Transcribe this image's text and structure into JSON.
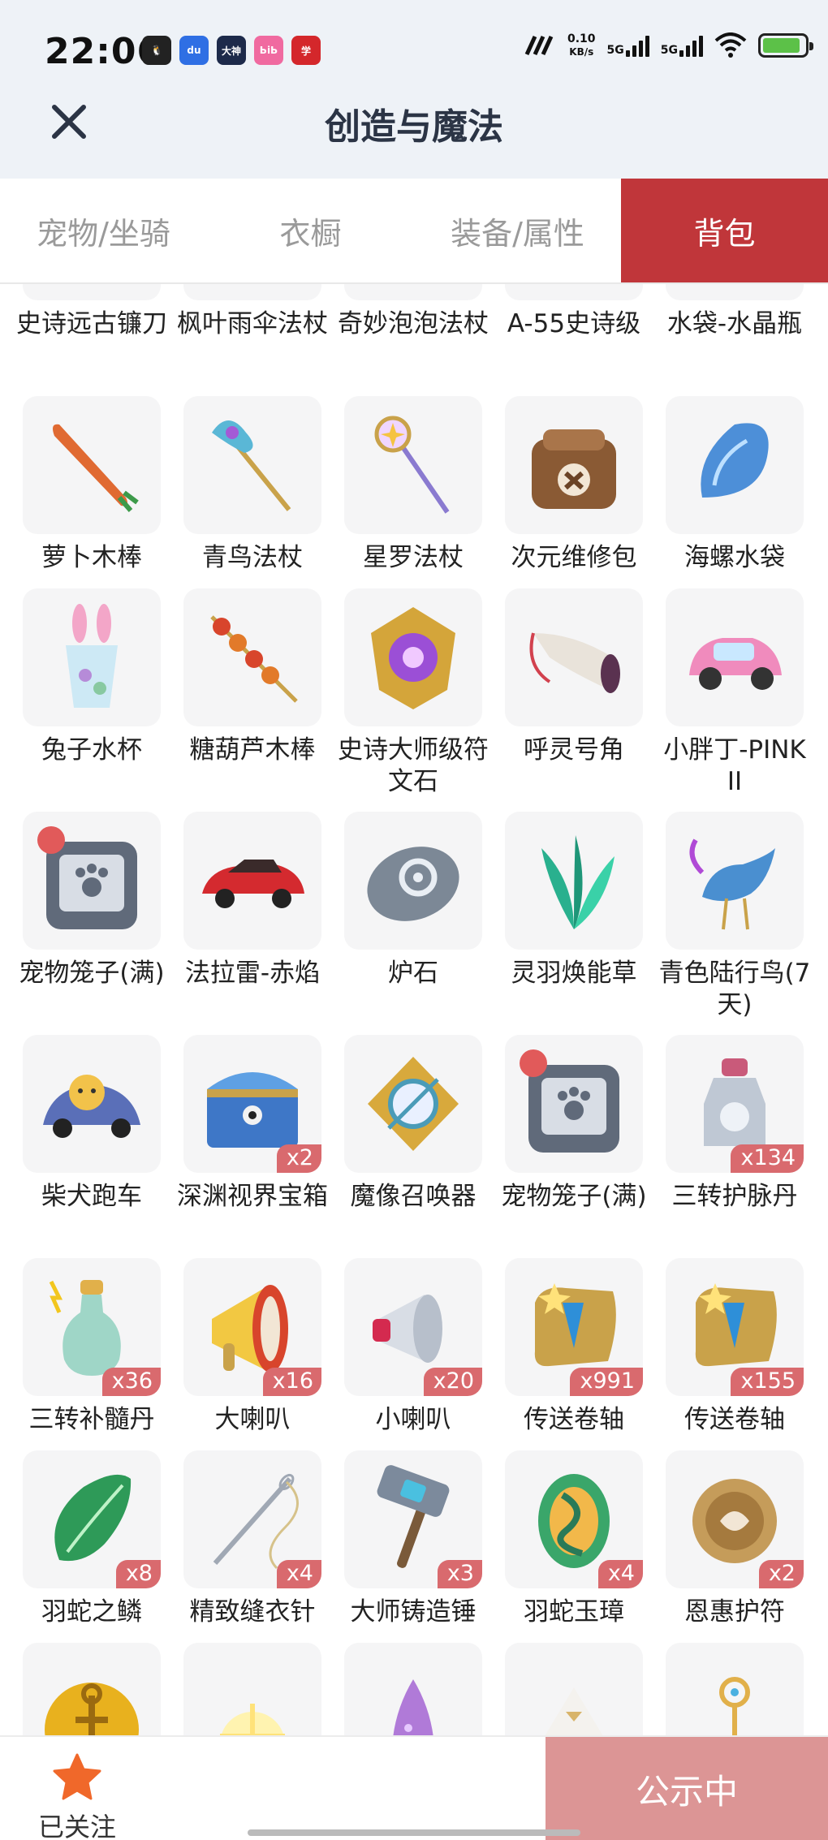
{
  "status_bar": {
    "time": "22:06",
    "network_speed_value": "0.10",
    "network_speed_unit": "KB/s",
    "signal1": "5G",
    "signal2": "5G",
    "apps": [
      {
        "name": "qq-icon",
        "color": "#222222",
        "text": "🐧"
      },
      {
        "name": "baidu-icon",
        "color": "#2f6fe4",
        "text": "du"
      },
      {
        "name": "dashen-icon",
        "color": "#1d2a4a",
        "text": "大神"
      },
      {
        "name": "bilibili-icon",
        "color": "#f06aa0",
        "text": "ЬiЬ"
      },
      {
        "name": "xuexi-icon",
        "color": "#d4272b",
        "text": "学"
      }
    ]
  },
  "header": {
    "title": "创造与魔法"
  },
  "tabs": [
    {
      "label": "宠物/坐骑",
      "active": false
    },
    {
      "label": "衣橱",
      "active": false
    },
    {
      "label": "装备/属性",
      "active": false
    },
    {
      "label": "背包",
      "active": true
    }
  ],
  "partial_row": [
    {
      "label": "史诗远古镰刀",
      "icon": "scythe"
    },
    {
      "label": "枫叶雨伞法杖",
      "icon": "umbrella-staff"
    },
    {
      "label": "奇妙泡泡法杖",
      "icon": "bubble-staff"
    },
    {
      "label": "A-55史诗级",
      "icon": "a55"
    },
    {
      "label": "水袋-水晶瓶",
      "icon": "crystal-bottle"
    }
  ],
  "items": [
    {
      "label": "萝卜木棒",
      "icon": "carrot",
      "qty": ""
    },
    {
      "label": "青鸟法杖",
      "icon": "bluebird-staff",
      "qty": ""
    },
    {
      "label": "星罗法杖",
      "icon": "star-staff",
      "qty": ""
    },
    {
      "label": "次元维修包",
      "icon": "repair-bag",
      "qty": ""
    },
    {
      "label": "海螺水袋",
      "icon": "conch",
      "qty": ""
    },
    {
      "label": "兔子水杯",
      "icon": "rabbit-cup",
      "qty": ""
    },
    {
      "label": "糖葫芦木棒",
      "icon": "candied-haws",
      "qty": ""
    },
    {
      "label": "史诗大师级符文石",
      "icon": "rune-stone",
      "qty": ""
    },
    {
      "label": "呼灵号角",
      "icon": "horn",
      "qty": ""
    },
    {
      "label": "小胖丁-PINK II",
      "icon": "pink-car",
      "qty": ""
    },
    {
      "label": "宠物笼子(满)",
      "icon": "pet-cage",
      "qty": ""
    },
    {
      "label": "法拉雷-赤焰",
      "icon": "red-car",
      "qty": ""
    },
    {
      "label": "炉石",
      "icon": "hearthstone",
      "qty": ""
    },
    {
      "label": "灵羽焕能草",
      "icon": "feather-grass",
      "qty": ""
    },
    {
      "label": "青色陆行鸟(7天)",
      "icon": "blue-bird",
      "qty": ""
    },
    {
      "label": "柴犬跑车",
      "icon": "shiba-car",
      "qty": ""
    },
    {
      "label": "深渊视界宝箱",
      "icon": "chest",
      "qty": "x2"
    },
    {
      "label": "魔像召唤器",
      "icon": "golem-summoner",
      "qty": ""
    },
    {
      "label": "宠物笼子(满)",
      "icon": "pet-cage",
      "qty": ""
    },
    {
      "label": "三转护脉丹",
      "icon": "bottle-grey",
      "qty": "x134"
    },
    {
      "label": "三转补髓丹",
      "icon": "bottle-green",
      "qty": "x36"
    },
    {
      "label": "大喇叭",
      "icon": "big-horn",
      "qty": "x16"
    },
    {
      "label": "小喇叭",
      "icon": "small-horn",
      "qty": "x20"
    },
    {
      "label": "传送卷轴",
      "icon": "scroll",
      "qty": "x991"
    },
    {
      "label": "传送卷轴",
      "icon": "scroll",
      "qty": "x155"
    },
    {
      "label": "羽蛇之鳞",
      "icon": "scale",
      "qty": "x8"
    },
    {
      "label": "精致缝衣针",
      "icon": "needle",
      "qty": "x4"
    },
    {
      "label": "大师铸造锤",
      "icon": "hammer",
      "qty": "x3"
    },
    {
      "label": "羽蛇玉璋",
      "icon": "jade",
      "qty": "x4"
    },
    {
      "label": "恩惠护符",
      "icon": "amulet",
      "qty": "x2"
    }
  ],
  "bottom_row_icons": [
    "gold-coin",
    "light-burst",
    "purple-crystal",
    "white-pyramid",
    "golden-key"
  ],
  "bottom_bar": {
    "follow_label": "已关注",
    "public_label": "公示中"
  }
}
